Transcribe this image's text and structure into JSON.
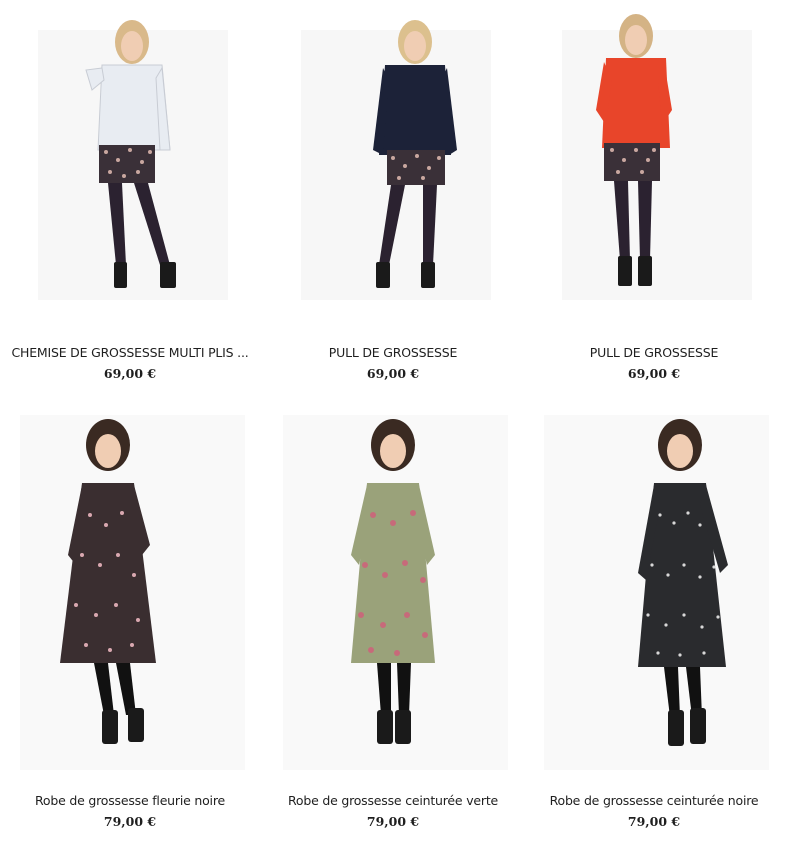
{
  "products": [
    {
      "name": "CHEMISE DE GROSSESSE MULTI PLIS ...",
      "price": "69,00 €",
      "top_color": "#e8ecf2",
      "image": "woman-white-shirt-printed-skirt"
    },
    {
      "name": "PULL DE GROSSESSE",
      "price": "69,00 €",
      "top_color": "#1c2238",
      "image": "woman-navy-sweater-printed-skirt"
    },
    {
      "name": "PULL DE GROSSESSE",
      "price": "69,00 €",
      "top_color": "#e8452a",
      "image": "woman-red-sweater-printed-skirt"
    },
    {
      "name": "Robe de grossesse fleurie noire",
      "price": "79,00 €",
      "top_color": "#3a2e30",
      "image": "woman-dark-floral-dress"
    },
    {
      "name": "Robe de grossesse ceinturée verte",
      "price": "79,00 €",
      "top_color": "#9aa27a",
      "image": "woman-green-belted-dress"
    },
    {
      "name": "Robe de grossesse ceinturée noire",
      "price": "79,00 €",
      "top_color": "#2a2b2e",
      "image": "woman-black-belted-dress"
    }
  ]
}
